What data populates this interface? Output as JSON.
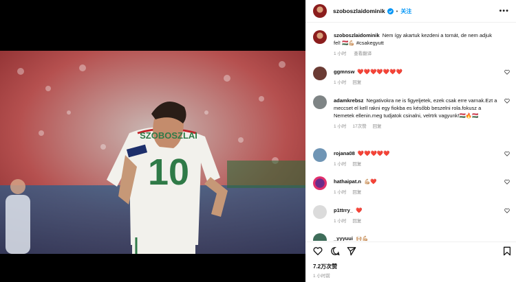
{
  "post": {
    "username": "szoboszlaidominik",
    "follow_label": "关注",
    "more_label": "•••",
    "caption": "Nem így akartuk kezdeni a tornát, de nem adjuk fel! 🇭🇺💪🏼 #csakegyutt",
    "caption_time": "1 小时",
    "caption_translate": "查看翻译",
    "likes": "7.2万次赞",
    "timestamp": "1 小时前"
  },
  "photo": {
    "jersey_name": "SZOBOSZLAI",
    "jersey_number": "10"
  },
  "comments": [
    {
      "user": "ggmnsw",
      "text": "❤️❤️❤️❤️❤️❤️❤️",
      "time": "1 小时",
      "reply": "回复",
      "likes": ""
    },
    {
      "user": "adamkrebsz",
      "text": "Negativokra ne is figyeljetek, ezek csak erre varnak.Ezt a meccset el kell rakni egy fiokba es később beszelni rola.fokusz a Nemetek ellenin.meg tudjatok csinalni, velrtrk vagyunk!🇭🇺🔥🇭🇺",
      "time": "1 小时",
      "reply": "回复",
      "likes": "17次赞"
    },
    {
      "user": "rojana08",
      "text": "❤️❤️❤️❤️❤️",
      "time": "1 小时",
      "reply": "回复",
      "likes": ""
    },
    {
      "user": "hathaipat.n",
      "text": "💪🏼❤️",
      "time": "1 小时",
      "reply": "回复",
      "likes": ""
    },
    {
      "user": "p1ttrry_",
      "text": "❤️",
      "time": "1 小时",
      "reply": "回复",
      "likes": ""
    },
    {
      "user": "_yyyuui",
      "text": "🙌🏼💪🏼",
      "time": "",
      "reply": "",
      "likes": ""
    }
  ],
  "icons": [
    "heart-icon",
    "comment-icon",
    "share-icon",
    "bookmark-icon",
    "verified-icon",
    "more-icon"
  ],
  "colors": {
    "accent": "#0095f6",
    "heart": "#ed2c3c",
    "meta": "#8e8e8e"
  }
}
